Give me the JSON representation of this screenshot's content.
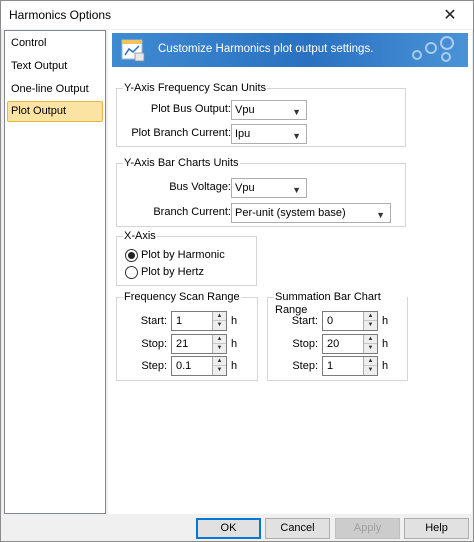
{
  "window": {
    "title": "Harmonics Options",
    "close_glyph": "✕"
  },
  "sidebar": {
    "items": [
      {
        "label": "Control"
      },
      {
        "label": "Text Output"
      },
      {
        "label": "One-line Output"
      },
      {
        "label": "Plot Output",
        "active": true
      }
    ]
  },
  "banner": {
    "text": "Customize Harmonics plot output settings."
  },
  "yaxis_freq": {
    "title": "Y-Axis Frequency Scan Units",
    "bus_label": "Plot Bus Output:",
    "bus_value": "Vpu",
    "branch_label": "Plot Branch Current:",
    "branch_value": "Ipu"
  },
  "yaxis_bar": {
    "title": "Y-Axis Bar Charts Units",
    "voltage_label": "Bus Voltage:",
    "voltage_value": "Vpu",
    "current_label": "Branch Current:",
    "current_value": "Per-unit (system base)"
  },
  "xaxis": {
    "title": "X-Axis",
    "opt_harmonic": "Plot by Harmonic",
    "opt_hertz": "Plot by Hertz",
    "selected": "harmonic"
  },
  "freq_range": {
    "title": "Frequency Scan Range",
    "start_label": "Start:",
    "start_value": "1",
    "stop_label": "Stop:",
    "stop_value": "21",
    "step_label": "Step:",
    "step_value": "0.1",
    "unit": "h"
  },
  "sum_range": {
    "title": "Summation Bar Chart Range",
    "start_label": "Start:",
    "start_value": "0",
    "stop_label": "Stop:",
    "stop_value": "20",
    "step_label": "Step:",
    "step_value": "1",
    "unit": "h"
  },
  "footer": {
    "ok": "OK",
    "cancel": "Cancel",
    "apply": "Apply",
    "help": "Help"
  },
  "icons": {
    "dropdown": "▼",
    "spin_up": "▲",
    "spin_down": "▼"
  }
}
